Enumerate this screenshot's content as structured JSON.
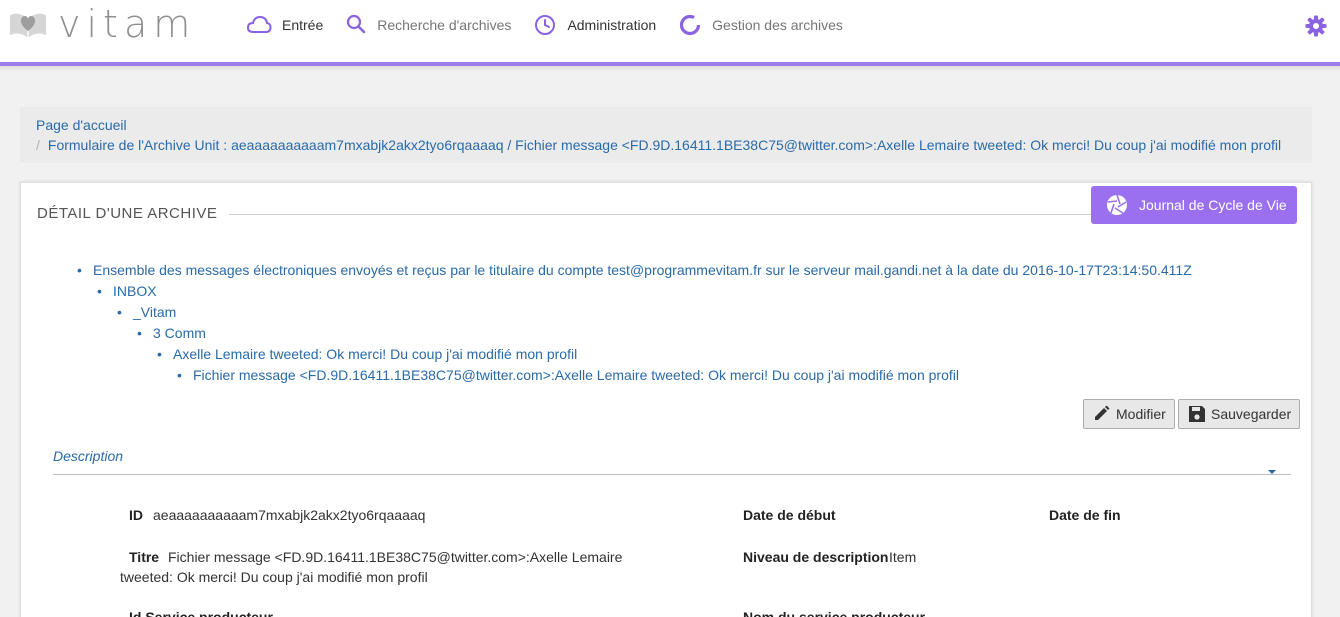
{
  "app": {
    "logo_text": "vitam"
  },
  "nav": {
    "items": [
      {
        "label": "Entrée",
        "icon": "cloud-icon"
      },
      {
        "label": "Recherche d'archives",
        "icon": "search-icon"
      },
      {
        "label": "Administration",
        "icon": "clock-icon"
      },
      {
        "label": "Gestion des archives",
        "icon": "spinner-icon"
      }
    ]
  },
  "breadcrumb": {
    "home": "Page d'accueil",
    "current": "Formulaire de l'Archive Unit : aeaaaaaaaaaam7mxabjk2akx2tyo6rqaaaaq / Fichier message <FD.9D.16411.1BE38C75@twitter.com>:Axelle Lemaire tweeted: Ok merci! Du coup j'ai modifié mon profil",
    "separator": "/"
  },
  "panel": {
    "title": "DÉTAIL D'UNE ARCHIVE",
    "journal_button": "Journal de Cycle de Vie"
  },
  "tree": [
    "Ensemble des messages électroniques envoyés et reçus par le titulaire du compte test@programmevitam.fr sur le serveur mail.gandi.net à la date du 2016-10-17T23:14:50.411Z",
    "INBOX",
    "_Vitam",
    "3 Comm",
    "Axelle Lemaire tweeted: Ok merci! Du coup j'ai modifié mon profil",
    "Fichier message <FD.9D.16411.1BE38C75@twitter.com>:Axelle Lemaire tweeted: Ok merci! Du coup j'ai modifié mon profil"
  ],
  "actions": {
    "modify": "Modifier",
    "save": "Sauvegarder"
  },
  "description": {
    "section_label": "Description",
    "id_label": "ID",
    "id_value": "aeaaaaaaaaaam7mxabjk2akx2tyo6rqaaaaq",
    "start_date_label": "Date de début",
    "end_date_label": "Date de fin",
    "title_label": "Titre",
    "title_value_line1": "Fichier message <FD.9D.16411.1BE38C75@twitter.com>:Axelle Lemaire",
    "title_value_line2": "tweeted: Ok merci! Du coup j'ai modifié mon profil",
    "level_label": "Niveau de description",
    "level_value": "Item",
    "producer_id_label": "Id Service producteur",
    "producer_name_label": "Nom du service producteur"
  },
  "colors": {
    "accent": "#9a7be8",
    "button": "#9a6ff0",
    "link": "#2a6aa8"
  }
}
